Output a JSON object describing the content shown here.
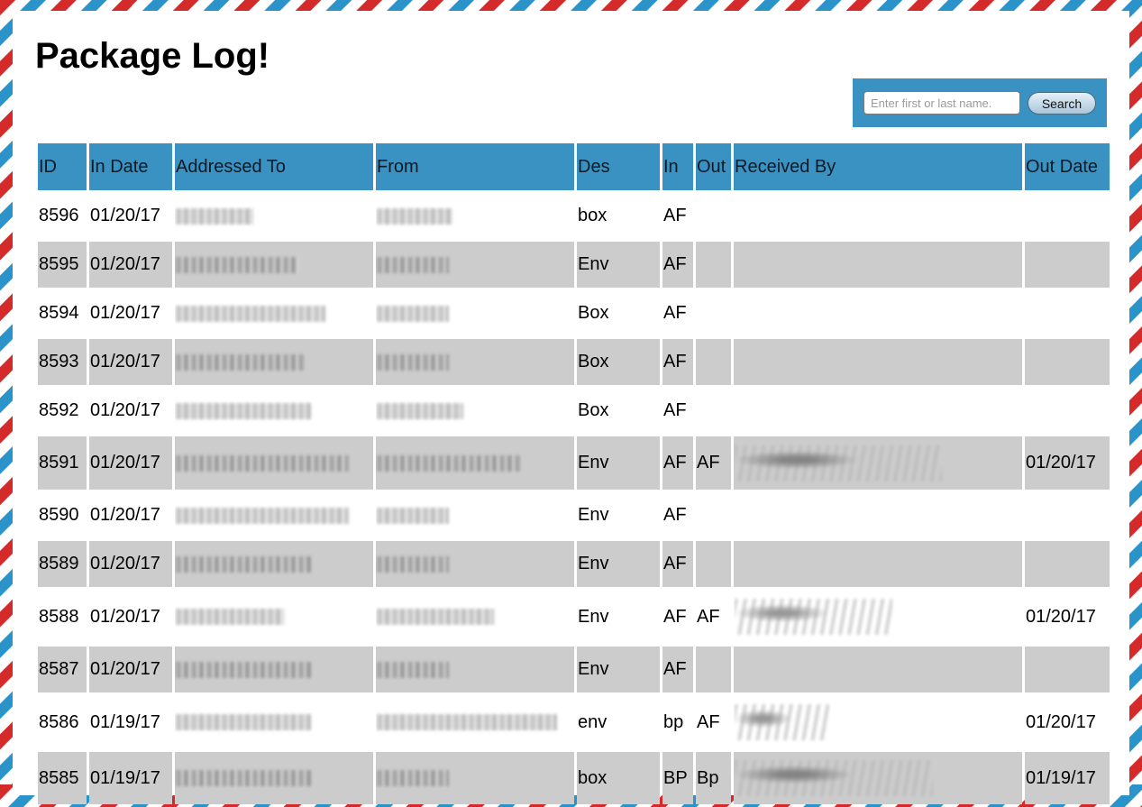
{
  "page": {
    "title": "Package Log!"
  },
  "search": {
    "placeholder": "Enter first or last name.",
    "button_label": "Search"
  },
  "table": {
    "headers": [
      "ID",
      "In Date",
      "Addressed To",
      "From",
      "Des",
      "In",
      "Out",
      "Received By",
      "Out Date"
    ],
    "rows": [
      {
        "id": "8596",
        "in_date": "01/20/17",
        "des": "box",
        "in": "AF",
        "out": "",
        "out_date": ""
      },
      {
        "id": "8595",
        "in_date": "01/20/17",
        "des": "Env",
        "in": "AF",
        "out": "",
        "out_date": ""
      },
      {
        "id": "8594",
        "in_date": "01/20/17",
        "des": "Box",
        "in": "AF",
        "out": "",
        "out_date": ""
      },
      {
        "id": "8593",
        "in_date": "01/20/17",
        "des": "Box",
        "in": "AF",
        "out": "",
        "out_date": ""
      },
      {
        "id": "8592",
        "in_date": "01/20/17",
        "des": "Box",
        "in": "AF",
        "out": "",
        "out_date": ""
      },
      {
        "id": "8591",
        "in_date": "01/20/17",
        "des": "Env",
        "in": "AF",
        "out": "AF",
        "out_date": "01/20/17"
      },
      {
        "id": "8590",
        "in_date": "01/20/17",
        "des": "Env",
        "in": "AF",
        "out": "",
        "out_date": ""
      },
      {
        "id": "8589",
        "in_date": "01/20/17",
        "des": "Env",
        "in": "AF",
        "out": "",
        "out_date": ""
      },
      {
        "id": "8588",
        "in_date": "01/20/17",
        "des": "Env",
        "in": "AF",
        "out": "AF",
        "out_date": "01/20/17"
      },
      {
        "id": "8587",
        "in_date": "01/20/17",
        "des": "Env",
        "in": "AF",
        "out": "",
        "out_date": ""
      },
      {
        "id": "8586",
        "in_date": "01/19/17",
        "des": "env",
        "in": "bp",
        "out": "AF",
        "out_date": "01/20/17"
      },
      {
        "id": "8585",
        "in_date": "01/19/17",
        "des": "box",
        "in": "BP",
        "out": "Bp",
        "out_date": "01/19/17"
      }
    ]
  },
  "colors": {
    "header_bg": "#3a92c2",
    "row_alt_bg": "#cccccc",
    "stripe_red": "#d42a2a",
    "stripe_blue": "#2a93c9"
  }
}
